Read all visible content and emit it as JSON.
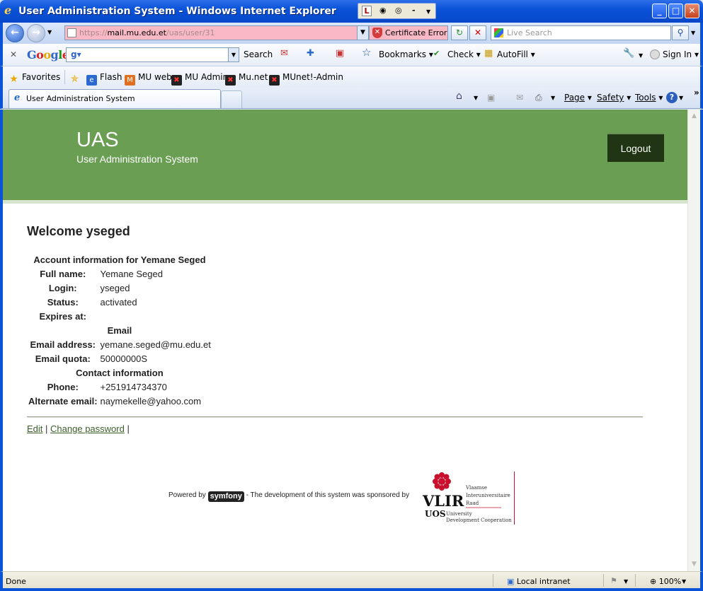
{
  "window": {
    "title": "User Administration System - Windows Internet Explorer",
    "title_tools": [
      "L",
      "-"
    ]
  },
  "address_bar": {
    "scheme": "https://",
    "host": "mail.mu.edu.et",
    "path": "/uas/user/31",
    "certificate_error": "Certificate Error",
    "search_placeholder": "Live Search"
  },
  "google_toolbar": {
    "search_label": "Search",
    "bookmarks": "Bookmarks",
    "check": "Check",
    "autofill": "AutoFill",
    "sign_in": "Sign In"
  },
  "favorites_bar": {
    "favorites": "Favorites",
    "items": [
      "Flash",
      "MU web",
      "MU Admin",
      "Mu.net",
      "MUnet!-Admin"
    ]
  },
  "tab": {
    "title": "User Administration System"
  },
  "command_bar": {
    "page": "Page",
    "safety": "Safety",
    "tools": "Tools"
  },
  "page": {
    "brand": "UAS",
    "brand_sub": "User Administration System",
    "logout": "Logout",
    "welcome": "Welcome yseged",
    "account_heading": "Account information for Yemane Seged",
    "fields": {
      "full_name_label": "Full name:",
      "full_name": "Yemane Seged",
      "login_label": "Login:",
      "login": "yseged",
      "status_label": "Status:",
      "status": "activated",
      "expires_label": "Expires at:",
      "expires": "",
      "email_heading": "Email",
      "email_address_label": "Email address:",
      "email_address": "yemane.seged@mu.edu.et",
      "email_quota_label": "Email quota:",
      "email_quota": "50000000S",
      "contact_heading": "Contact information",
      "phone_label": "Phone:",
      "phone": "+251914734370",
      "alt_email_label": "Alternate email:",
      "alt_email": "naymekelle@yahoo.com"
    },
    "links": {
      "edit": "Edit",
      "sep": "|",
      "change_password": "Change password"
    },
    "footer": {
      "powered_by": "Powered by",
      "symfony": "symfony",
      "sponsor_text": "-  The development of this system was sponsored by",
      "vlir": "VLIR",
      "uos": "UOS",
      "vlir_line1": "Vlaamse",
      "vlir_line2": "Interuniversitaire",
      "vlir_line3": "Raad",
      "uos_line1": "University",
      "uos_line2": "Development Cooperation"
    }
  },
  "status_bar": {
    "text": "Done",
    "zone": "Local intranet",
    "zoom": "100%"
  }
}
